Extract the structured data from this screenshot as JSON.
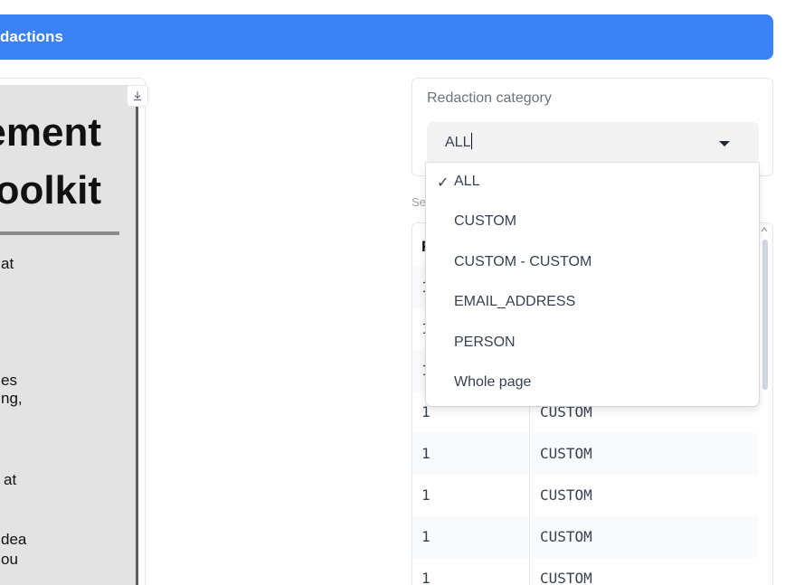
{
  "header": {
    "title": "dactions"
  },
  "document": {
    "heading_line1": "ement",
    "heading_line2": "Toolkit",
    "text_fragments": [
      "at",
      "es",
      "ng,",
      "at",
      "dea",
      "ou"
    ]
  },
  "category": {
    "label": "Redaction category",
    "selected": "ALL"
  },
  "dropdown": {
    "checkmark": "✓",
    "options": [
      "ALL",
      "CUSTOM",
      "CUSTOM - CUSTOM",
      "EMAIL_ADDRESS",
      "PERSON",
      "Whole page"
    ]
  },
  "table": {
    "hidden_label": "Se",
    "header_fragment": "F",
    "rows": [
      {
        "page": "1",
        "label": ""
      },
      {
        "page": "1",
        "label": ""
      },
      {
        "page": "1",
        "label": ""
      },
      {
        "page": "1",
        "label": "CUSTOM"
      },
      {
        "page": "1",
        "label": "CUSTOM"
      },
      {
        "page": "1",
        "label": "CUSTOM"
      },
      {
        "page": "1",
        "label": "CUSTOM"
      },
      {
        "page": "1",
        "label": "CUSTOM"
      }
    ]
  },
  "colors": {
    "accent": "#3b82f6",
    "panel_border": "#e5e7eb"
  }
}
